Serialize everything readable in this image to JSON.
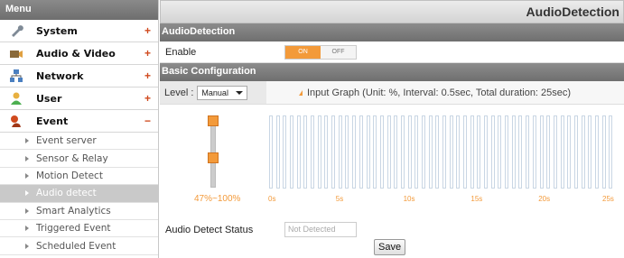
{
  "sidebar": {
    "title": "Menu",
    "items": [
      {
        "label": "System",
        "icon": "wrench-icon",
        "toggle": "+"
      },
      {
        "label": "Audio & Video",
        "icon": "camera-icon",
        "toggle": "+"
      },
      {
        "label": "Network",
        "icon": "network-icon",
        "toggle": "+"
      },
      {
        "label": "User",
        "icon": "user-icon",
        "toggle": "+"
      },
      {
        "label": "Event",
        "icon": "alarm-icon",
        "toggle": "−"
      }
    ],
    "subitems": [
      "Event server",
      "Sensor & Relay",
      "Motion Detect",
      "Audio detect",
      "Smart Analytics",
      "Triggered Event",
      "Scheduled Event"
    ],
    "active_subitem": "Audio detect"
  },
  "page": {
    "title": "AudioDetection"
  },
  "section1": {
    "title": "AudioDetection",
    "enable_label": "Enable",
    "on_label": "ON",
    "off_label": "OFF"
  },
  "section2": {
    "title": "Basic Configuration",
    "level_label": "Level :",
    "level_value": "Manual",
    "graph_label": "Input Graph (Unit: %, Interval: 0.5sec, Total duration: 25sec)",
    "slider_range": "47%~100%",
    "ticks": [
      "0s",
      "5s",
      "10s",
      "15s",
      "20s",
      "25s"
    ]
  },
  "status": {
    "label": "Audio Detect Status",
    "value": "Not Detected"
  },
  "save_label": "Save",
  "colors": {
    "accent": "#f39a3a",
    "header": "#7a7a7a"
  }
}
